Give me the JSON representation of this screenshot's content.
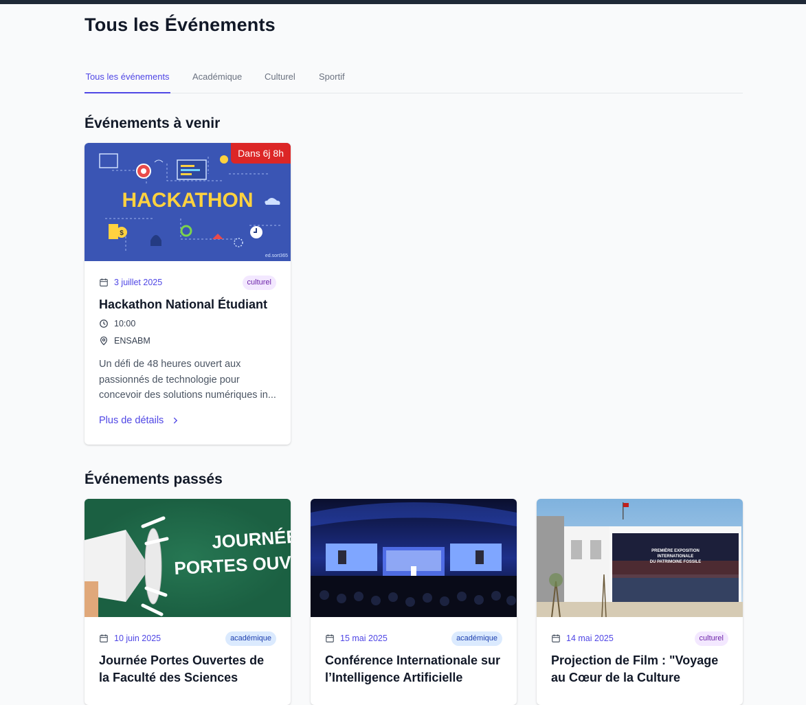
{
  "page": {
    "title": "Tous les Événements"
  },
  "tabs": [
    {
      "label": "Tous les événements",
      "active": true
    },
    {
      "label": "Académique",
      "active": false
    },
    {
      "label": "Culturel",
      "active": false
    },
    {
      "label": "Sportif",
      "active": false
    }
  ],
  "sections": {
    "upcoming_title": "Événements à venir",
    "past_title": "Événements passés"
  },
  "upcoming": [
    {
      "countdown": "Dans 6j 8h",
      "date": "3 juillet 2025",
      "category": "culturel",
      "title": "Hackathon National Étudiant",
      "time": "10:00",
      "location": "ENSABM",
      "description": "Un défi de 48 heures ouvert aux passionnés de technologie pour concevoir des solutions numériques in...",
      "more_label": "Plus de détails",
      "image_text": "HACKATHON",
      "image_credit": "ed.sort365"
    }
  ],
  "past": [
    {
      "date": "10 juin 2025",
      "category": "académique",
      "title": "Journée Portes Ouvertes de la Faculté des Sciences",
      "image_text_line1": "JOURNÉE",
      "image_text_line2": "PORTES OUVE"
    },
    {
      "date": "15 mai 2025",
      "category": "académique",
      "title": "Conférence Internationale sur l’Intelligence Artificielle"
    },
    {
      "date": "14 mai 2025",
      "category": "culturel",
      "title": "Projection de Film : \"Voyage au Cœur de la Culture",
      "image_text_line1": "PREMIÈRE EXPOSITION",
      "image_text_line2": "INTERNATIONALE",
      "image_text_line3": "DU PATRIMOINE FOSSILE"
    }
  ],
  "colors": {
    "accent": "#4f46e5",
    "countdown": "#dc2626",
    "topbar": "#1f2937"
  }
}
